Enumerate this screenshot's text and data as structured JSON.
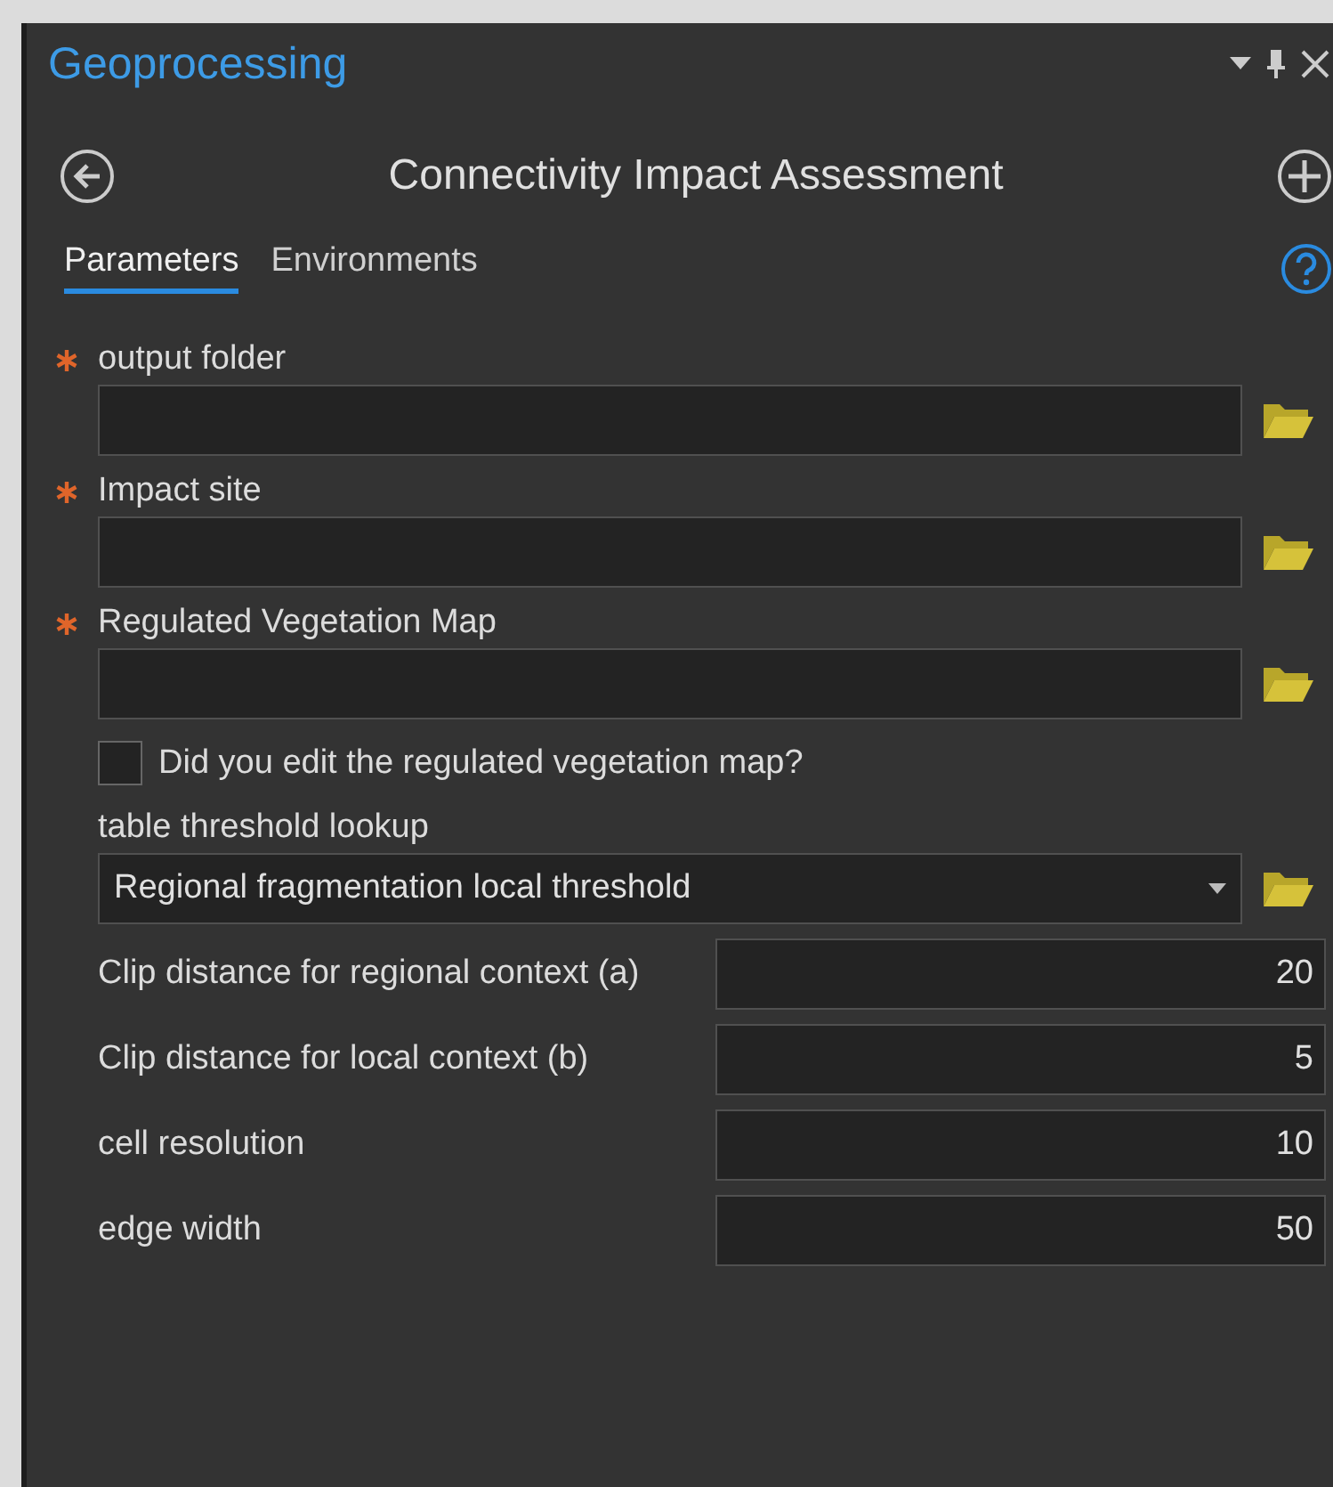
{
  "pane": {
    "title": "Geoprocessing"
  },
  "tool": {
    "title": "Connectivity Impact Assessment"
  },
  "tabs": [
    {
      "label": "Parameters",
      "selected": true
    },
    {
      "label": "Environments",
      "selected": false
    }
  ],
  "parameters": [
    {
      "kind": "file",
      "label": "output folder",
      "required": true
    },
    {
      "kind": "file",
      "label": "Impact site",
      "required": true
    },
    {
      "kind": "file",
      "label": "Regulated Vegetation Map",
      "required": true
    },
    {
      "kind": "checkbox",
      "label": "Did you edit the regulated vegetation map?",
      "checked": false
    },
    {
      "kind": "dropdown",
      "label": "table threshold lookup",
      "value": "Regional fragmentation local threshold"
    },
    {
      "kind": "number",
      "label": "Clip distance for regional context (a)",
      "value": "20"
    },
    {
      "kind": "number",
      "label": "Clip distance for local context (b)",
      "value": "5"
    },
    {
      "kind": "number",
      "label": "cell resolution",
      "value": "10"
    },
    {
      "kind": "number",
      "label": "edge width",
      "value": "50"
    }
  ]
}
